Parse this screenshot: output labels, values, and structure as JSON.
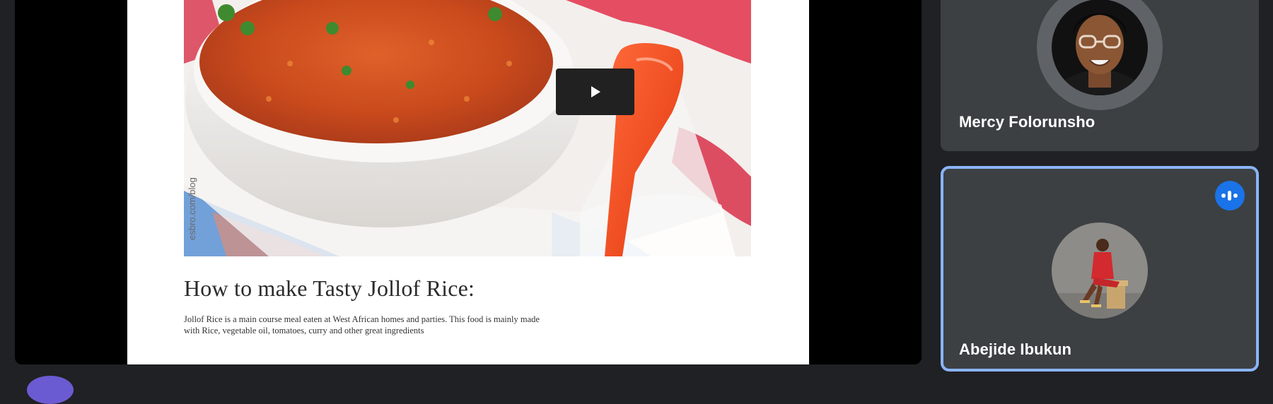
{
  "presentation": {
    "slide": {
      "image_watermark": "esbro.com/blog",
      "image_alt": "jollof rice in a white dish with an orange serving spoon",
      "play_icon": "play-icon",
      "title": "How to make Tasty Jollof Rice:",
      "body_line1": "Jollof Rice is a main course meal eaten at West African homes and parties. This food is mainly made",
      "body_line2": "with Rice, vegetable oil, tomatoes, curry and other great ingredients"
    }
  },
  "participants": [
    {
      "name": "Mercy Folorunsho",
      "speaking": false
    },
    {
      "name": "Abejide Ibukun",
      "speaking": true,
      "indicator_icon": "audio-level-icon"
    }
  ],
  "colors": {
    "background": "#202124",
    "tile": "#3c4043",
    "active_speaker_border": "#8ab4f8",
    "speaking_badge": "#1a73e8"
  }
}
